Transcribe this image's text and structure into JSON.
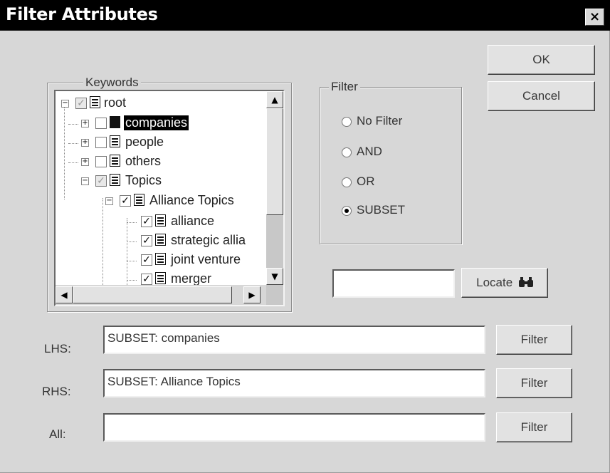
{
  "window": {
    "title": "Filter Attributes",
    "close_glyph": "×"
  },
  "buttons": {
    "ok": "OK",
    "cancel": "Cancel",
    "locate": "Locate",
    "locate_icon": "binoculars-icon"
  },
  "keywords": {
    "label": "Keywords",
    "items": [
      {
        "label": "root",
        "checked": "partial",
        "expander": "−",
        "icon": "document-icon"
      },
      {
        "label": "companies",
        "checked": "none",
        "expander": "+",
        "icon": "folder-icon",
        "selected": true
      },
      {
        "label": "people",
        "checked": "none",
        "expander": "+",
        "icon": "document-icon"
      },
      {
        "label": "others",
        "checked": "none",
        "expander": "+",
        "icon": "document-icon"
      },
      {
        "label": "Topics",
        "checked": "partial",
        "expander": "−",
        "icon": "document-icon"
      },
      {
        "label": "Alliance Topics",
        "checked": "checked",
        "expander": "−",
        "icon": "document-icon"
      },
      {
        "label": "alliance",
        "checked": "checked",
        "icon": "document-icon"
      },
      {
        "label": "strategic allia",
        "checked": "checked",
        "icon": "document-icon"
      },
      {
        "label": "joint venture",
        "checked": "checked",
        "icon": "document-icon"
      },
      {
        "label": "merger",
        "checked": "checked",
        "icon": "document-icon"
      }
    ]
  },
  "filter": {
    "label": "Filter",
    "options": [
      {
        "label": "No Filter",
        "selected": false
      },
      {
        "label": "AND",
        "selected": false
      },
      {
        "label": "OR",
        "selected": false
      },
      {
        "label": "SUBSET",
        "selected": true
      }
    ]
  },
  "locate_input": {
    "value": ""
  },
  "rows": [
    {
      "label": "LHS:",
      "value": "SUBSET: companies",
      "button": "Filter"
    },
    {
      "label": "RHS:",
      "value": "SUBSET: Alliance Topics",
      "button": "Filter"
    },
    {
      "label": "All:",
      "value": "",
      "button": "Filter"
    }
  ]
}
